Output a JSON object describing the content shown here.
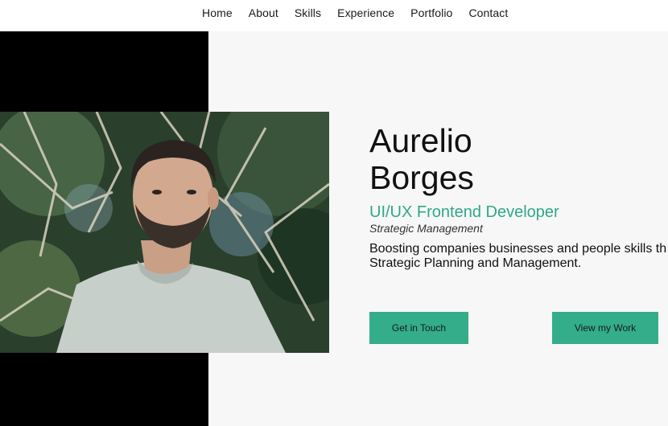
{
  "nav": {
    "items": [
      "Home",
      "About",
      "Skills",
      "Experience",
      "Portfolio",
      "Contact"
    ]
  },
  "hero": {
    "first_name": "Aurelio",
    "last_name": "Borges",
    "role": "UI/UX Frontend Developer",
    "subtitle": "Strategic Management",
    "tagline_line1": "Boosting companies businesses and people skills th",
    "tagline_line2": "Strategic Planning and Management.",
    "primary_button": "Get in Touch",
    "secondary_button": "View my Work"
  },
  "colors": {
    "accent": "#2fa886",
    "button": "#33ad8a",
    "panel": "#000000",
    "background": "#f7f7f7"
  }
}
